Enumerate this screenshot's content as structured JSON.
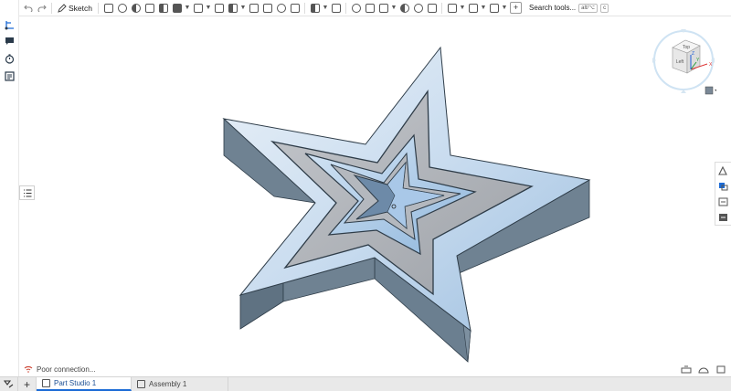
{
  "toolbar": {
    "undo_icon": "undo-icon",
    "redo_icon": "redo-icon",
    "sketch_label": "Sketch",
    "search_label": "Search tools...",
    "search_shortcut_1": "alt/⌥",
    "search_shortcut_2": "c"
  },
  "left_rail": {
    "items": [
      "feature-tree-icon",
      "mate-connector-icon",
      "comment-icon",
      "history-icon",
      "variables-icon"
    ]
  },
  "viewcube": {
    "top_label": "Top",
    "left_label": "Left",
    "axis_x": "X",
    "axis_y": "Y",
    "axis_z": "Z"
  },
  "status": {
    "connection_text": "Poor connection..."
  },
  "tabs": {
    "items": [
      {
        "label": "Part Studio 1",
        "active": true
      },
      {
        "label": "Assembly 1",
        "active": false
      }
    ]
  },
  "colors": {
    "accent": "#1c6bd6",
    "star_face_light": "#d8e6f3",
    "star_face_blue": "#a9c8e8",
    "star_gray": "#aeb1b7",
    "star_side": "#6d7f8f"
  }
}
